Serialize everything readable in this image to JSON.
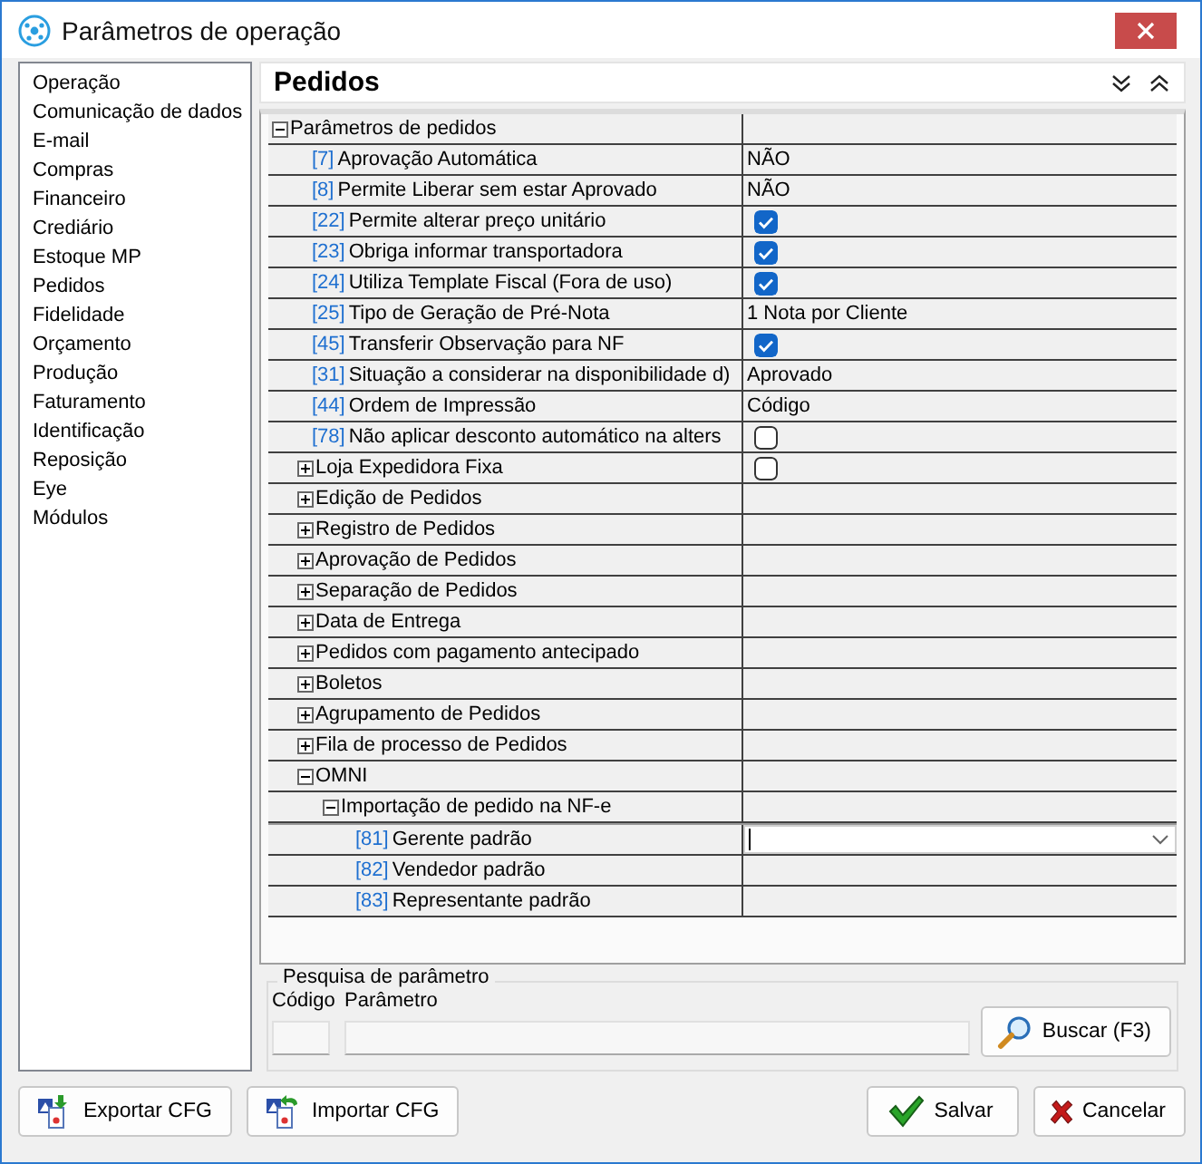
{
  "window": {
    "title": "Parâmetros de operação"
  },
  "sidebar": {
    "items": [
      {
        "label": "Operação",
        "selected": false
      },
      {
        "label": "Comunicação de dados",
        "selected": false
      },
      {
        "label": "E-mail",
        "selected": false
      },
      {
        "label": "Compras",
        "selected": false
      },
      {
        "label": "Financeiro",
        "selected": false
      },
      {
        "label": "Crediário",
        "selected": false
      },
      {
        "label": "Estoque MP",
        "selected": false
      },
      {
        "label": "Pedidos",
        "selected": false
      },
      {
        "label": "Fidelidade",
        "selected": false
      },
      {
        "label": "Orçamento",
        "selected": false
      },
      {
        "label": "Produção",
        "selected": false
      },
      {
        "label": "Faturamento",
        "selected": false
      },
      {
        "label": "Identificação",
        "selected": false
      },
      {
        "label": "Reposição",
        "selected": false
      },
      {
        "label": "Eye",
        "selected": false
      },
      {
        "label": "Módulos",
        "selected": false
      }
    ]
  },
  "panel": {
    "title": "Pedidos",
    "rows": [
      {
        "kind": "group",
        "label": "Parâmetros de pedidos",
        "expanded": true,
        "children": [
          {
            "kind": "param",
            "code": "[7]",
            "label": "Aprovação Automática",
            "value": {
              "kind": "text",
              "text": "NÃO"
            }
          },
          {
            "kind": "param",
            "code": "[8]",
            "label": "Permite Liberar sem estar Aprovado",
            "value": {
              "kind": "text",
              "text": "NÃO"
            }
          },
          {
            "kind": "param",
            "code": "[22]",
            "label": "Permite alterar preço unitário",
            "value": {
              "kind": "checkbox",
              "checked": true
            }
          },
          {
            "kind": "param",
            "code": "[23]",
            "label": "Obriga informar transportadora",
            "value": {
              "kind": "checkbox",
              "checked": true
            }
          },
          {
            "kind": "param",
            "code": "[24]",
            "label": "Utiliza Template Fiscal (Fora de uso)",
            "value": {
              "kind": "checkbox",
              "checked": true
            }
          },
          {
            "kind": "param",
            "code": "[25]",
            "label": "Tipo de Geração de Pré-Nota",
            "value": {
              "kind": "text",
              "text": "1 Nota por Cliente"
            }
          },
          {
            "kind": "param",
            "code": "[45]",
            "label": "Transferir Observação para NF",
            "value": {
              "kind": "checkbox",
              "checked": true
            }
          },
          {
            "kind": "param",
            "code": "[31]",
            "label": "Situação a considerar na disponibilidade d)",
            "value": {
              "kind": "text",
              "text": "Aprovado"
            }
          },
          {
            "kind": "param",
            "code": "[44]",
            "label": "Ordem de Impressão",
            "value": {
              "kind": "text",
              "text": "Código"
            }
          },
          {
            "kind": "param",
            "code": "[78]",
            "label": "Não aplicar desconto automático na alters",
            "value": {
              "kind": "checkbox",
              "checked": false
            }
          },
          {
            "kind": "group",
            "label": "Loja Expedidora Fixa",
            "expanded": false,
            "value": {
              "kind": "checkbox",
              "checked": false
            }
          },
          {
            "kind": "group",
            "label": "Edição de Pedidos",
            "expanded": false
          },
          {
            "kind": "group",
            "label": "Registro de Pedidos",
            "expanded": false
          },
          {
            "kind": "group",
            "label": "Aprovação de Pedidos",
            "expanded": false
          },
          {
            "kind": "group",
            "label": "Separação de Pedidos",
            "expanded": false
          },
          {
            "kind": "group",
            "label": "Data de Entrega",
            "expanded": false
          },
          {
            "kind": "group",
            "label": "Pedidos com pagamento antecipado",
            "expanded": false
          },
          {
            "kind": "group",
            "label": "Boletos",
            "expanded": false
          },
          {
            "kind": "group",
            "label": "Agrupamento de Pedidos",
            "expanded": false
          },
          {
            "kind": "group",
            "label": "Fila de processo de Pedidos",
            "expanded": false
          },
          {
            "kind": "group",
            "label": "OMNI",
            "expanded": true,
            "children": [
              {
                "kind": "group",
                "label": "Importação de pedido na NF-e",
                "expanded": true,
                "children": [
                  {
                    "kind": "param",
                    "code": "[81]",
                    "label": "Gerente padrão",
                    "value": {
                      "kind": "combo"
                    }
                  },
                  {
                    "kind": "param",
                    "code": "[82]",
                    "label": "Vendedor padrão"
                  },
                  {
                    "kind": "param",
                    "code": "[83]",
                    "label": "Representante padrão"
                  }
                ]
              }
            ]
          }
        ]
      }
    ]
  },
  "search": {
    "title": "Pesquisa de parâmetro",
    "fields": [
      {
        "label": "Código"
      },
      {
        "label": "Parâmetro"
      }
    ],
    "button": "Buscar (F3)"
  },
  "buttons": [
    {
      "kind": "export",
      "label": "Exportar CFG"
    },
    {
      "kind": "import",
      "label": "Importar CFG"
    },
    {
      "kind": "save",
      "label": "Salvar"
    },
    {
      "kind": "cancel",
      "label": "Cancelar"
    }
  ]
}
